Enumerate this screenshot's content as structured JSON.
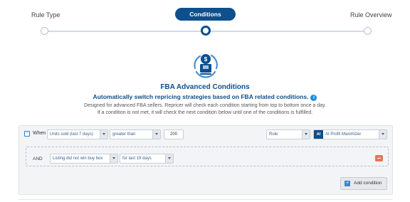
{
  "stepper": {
    "steps": [
      {
        "label": "Rule Type",
        "state": "done"
      },
      {
        "label": "Conditions",
        "state": "active"
      },
      {
        "label": "Rule Overview",
        "state": "pending"
      }
    ]
  },
  "hero": {
    "icon": "fba-box-dollar-icon",
    "title": "FBA Advanced Conditions",
    "subtitle": "Automatically switch repricing strategies based on FBA related conditions.",
    "description_line1": "Designed for advanced FBA sellers. Repricer will check each condition starting from top to bottom once a day.",
    "description_line2": "If a condition is not met, it will check the next condition below until one of the conditions is fulfilled."
  },
  "condition": {
    "collapse_symbol": "−",
    "when_label": "When",
    "metric": "Units sold (last 7 days)",
    "operator": "greater than",
    "value": "200",
    "action": "Rule",
    "strategy_badge": "AI",
    "strategy": "AI Profit Maximizer",
    "and_label": "AND",
    "and_metric": "Listing did not win buy box",
    "and_period": "for last 19 days",
    "add_button": "Add condition",
    "add_symbol": "+"
  },
  "colors": {
    "primary": "#0f4f8c",
    "info": "#1e8ad6",
    "danger": "#e8735c",
    "panel": "#f3f4f6"
  }
}
